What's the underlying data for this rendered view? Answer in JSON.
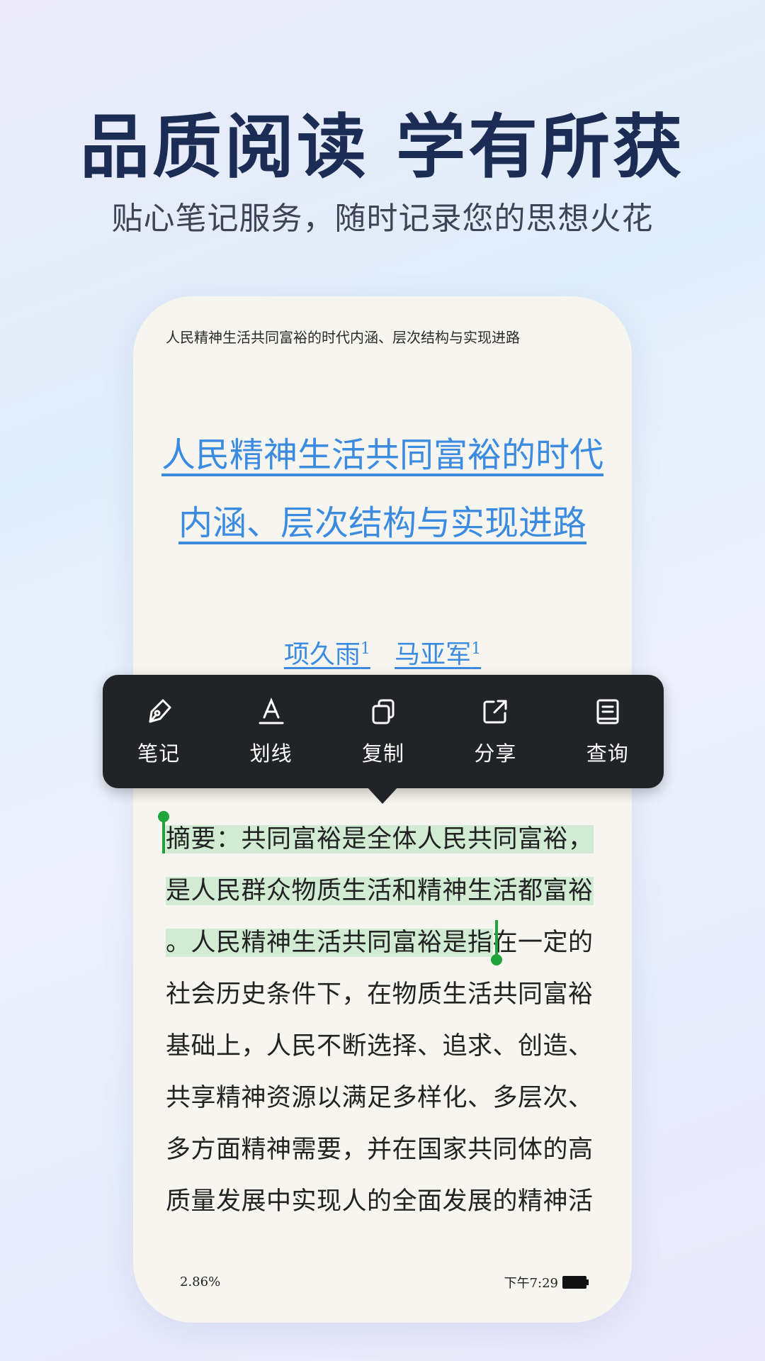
{
  "headline": "品质阅读 学有所获",
  "subheadline": "贴心笔记服务，随时记录您的思想火花",
  "reader": {
    "running_head": "人民精神生活共同富裕的时代内涵、层次结构与实现进路",
    "title_line1": "人民精神生活共同富裕的时代",
    "title_line2": "内涵、层次结构与实现进路",
    "author1": "项久雨",
    "author1_sup": "1",
    "author2": "马亚军",
    "author2_sup": "1",
    "body": {
      "line1": "摘要：共同富裕是全体人民共同富裕，",
      "line2": "是人民群众物质生活和精神生活都富裕",
      "line3_selected": "。人民精神生活共同富裕是指",
      "line3_rest": "在一定的",
      "line4": "社会历史条件下，在物质生活共同富裕",
      "line5": "基础上，人民不断选择、追求、创造、",
      "line6": "共享精神资源以满足多样化、多层次、",
      "line7": "多方面精神需要，并在国家共同体的高",
      "line8": "质量发展中实现人的全面发展的精神活"
    },
    "progress": "2.86%",
    "time": "下午7:29"
  },
  "menu": {
    "items": [
      {
        "label": "笔记",
        "icon": "pen-icon"
      },
      {
        "label": "划线",
        "icon": "underline-icon"
      },
      {
        "label": "复制",
        "icon": "copy-icon"
      },
      {
        "label": "分享",
        "icon": "share-icon"
      },
      {
        "label": "查询",
        "icon": "lookup-icon"
      }
    ]
  },
  "colors": {
    "headline": "#1b2c55",
    "link": "#3b8be0",
    "highlight": "#d2ecd3",
    "cursor": "#1fa43a",
    "menu_bg": "#222326"
  }
}
